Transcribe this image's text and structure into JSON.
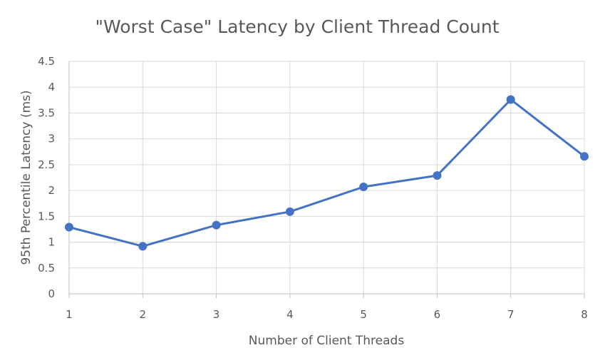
{
  "chart_data": {
    "type": "line",
    "title": "\"Worst Case\" Latency by Client Thread Count",
    "xlabel": "Number of Client Threads",
    "ylabel": "95th Percentile Latency (ms)",
    "x": [
      1,
      2,
      3,
      4,
      5,
      6,
      7,
      8
    ],
    "x_tick_labels": [
      "1",
      "2",
      "3",
      "4",
      "5",
      "6",
      "7",
      "8"
    ],
    "y_tick_labels": [
      "0",
      "0.5",
      "1",
      "1.5",
      "2",
      "2.5",
      "3",
      "3.5",
      "4",
      "4.5"
    ],
    "ylim": [
      0,
      4.5
    ],
    "y_ticks": [
      0,
      0.5,
      1,
      1.5,
      2,
      2.5,
      3,
      3.5,
      4,
      4.5
    ],
    "grid": true,
    "legend": "none",
    "series": [
      {
        "values": [
          1.29,
          0.92,
          1.33,
          1.59,
          2.07,
          2.29,
          3.76,
          2.66
        ],
        "color": "#4472c4"
      }
    ]
  }
}
